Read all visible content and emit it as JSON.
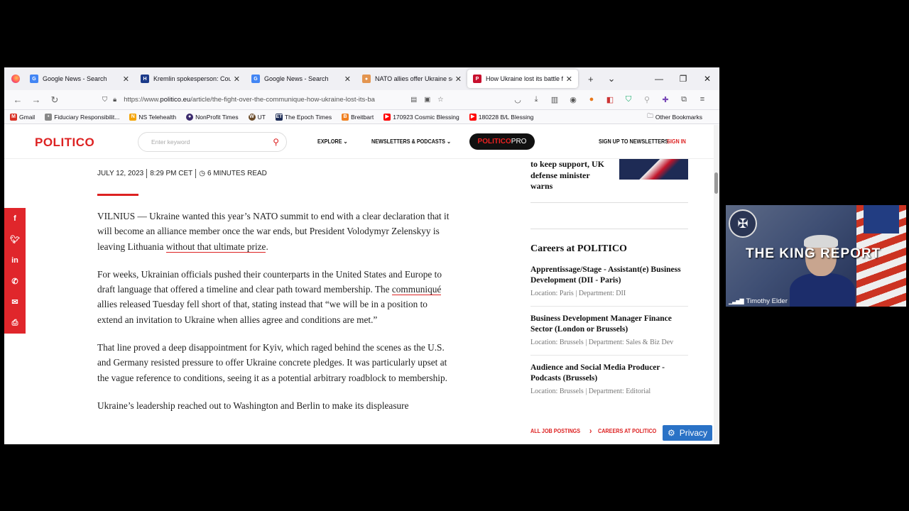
{
  "browser": {
    "tabs": [
      {
        "title": "Google News - Search",
        "fav_color": "#4285f4",
        "fav_glyph": "G"
      },
      {
        "title": "Kremlin spokesperson: Count",
        "fav_color": "#1b3a8a",
        "fav_glyph": "H"
      },
      {
        "title": "Google News - Search",
        "fav_color": "#4285f4",
        "fav_glyph": "G"
      },
      {
        "title": "NATO allies offer Ukraine secu",
        "fav_color": "#e39550",
        "fav_glyph": "●"
      },
      {
        "title": "How Ukraine lost its battle fo",
        "fav_color": "#c8102e",
        "fav_glyph": "P"
      }
    ],
    "url_prefix": "https://www.",
    "url_domain": "politico.eu",
    "url_path": "/article/the-fight-over-the-communique-how-ukraine-lost-its-ba",
    "bookmarks": [
      {
        "label": "Gmail",
        "color": "#d93025",
        "glyph": "M"
      },
      {
        "label": "Fiduciary Responsibilit...",
        "color": "#888888",
        "glyph": "•"
      },
      {
        "label": "NS Telehealth",
        "color": "#f4a300",
        "glyph": "N"
      },
      {
        "label": "NonProfit Times",
        "color": "#3b2a6d",
        "glyph": "●"
      },
      {
        "label": "UT",
        "color": "#6a4b2a",
        "glyph": "W"
      },
      {
        "label": "The Epoch Times",
        "color": "#1b2a55",
        "glyph": "ET"
      },
      {
        "label": "Breitbart",
        "color": "#f08020",
        "glyph": "B"
      },
      {
        "label": "170923 Cosmic Blessing",
        "color": "#ff0000",
        "glyph": "▶"
      },
      {
        "label": "180228 B/L Blessing",
        "color": "#ff0000",
        "glyph": "▶"
      }
    ],
    "other_bookmarks": "Other Bookmarks"
  },
  "site": {
    "logo": "POLITICO",
    "search_placeholder": "Enter keyword",
    "explore": "EXPLORE",
    "newsletters": "NEWSLETTERS & PODCASTS",
    "pro_prefix": "POLITICO",
    "pro_suffix": "PRO",
    "signup": "SIGN UP TO NEWSLETTERS",
    "signin": "SIGN IN"
  },
  "article": {
    "date": "JULY 12, 2023",
    "time": "8:29 PM CET",
    "read_time": "6 MINUTES READ",
    "p1_a": "VILNIUS — Ukraine wanted this year’s NATO summit to end with a clear declaration that it will become an alliance member once the war ends, but President Volodymyr Zelenskyy is leaving Lithuania ",
    "p1_link": "without that ultimate prize",
    "p1_b": ".",
    "p2_a": "For weeks, Ukrainian officials pushed their counterparts in the United States and Europe to draft language that offered a timeline and clear path toward membership. The ",
    "p2_link": "communiqué",
    "p2_b": " allies released Tuesday fell short of that, stating instead that “we will be in a position to extend an invitation to Ukraine when allies agree and conditions are met.”",
    "p3": "That line proved a deep disappointment for Kyiv, which raged behind the scenes as the U.S. and Germany resisted pressure to offer Ukraine concrete pledges. It was particularly upset at the vague reference to conditions, seeing it as a potential arbitrary roadblock to membership.",
    "p4": "Ukraine’s leadership reached out to Washington and Berlin to make its displeasure"
  },
  "rail": {
    "prev_story": "to keep support, UK defense minister warns",
    "careers_title": "Careers at POLITICO",
    "jobs": [
      {
        "title": "Apprentissage/Stage - Assistant(e) Business Development (DII - Paris)",
        "meta": "Location: Paris | Department: DII"
      },
      {
        "title": "Business Development Manager Finance Sector (London or Brussels)",
        "meta": "Location: Brussels | Department: Sales & Biz Dev"
      },
      {
        "title": "Audience and Social Media Producer - Podcasts (Brussels)",
        "meta": "Location: Brussels | Department: Editorial"
      }
    ],
    "all_jobs": "ALL JOB POSTINGS",
    "careers_link": "CAREERS AT POLITICO",
    "privacy": "Privacy"
  },
  "webcam": {
    "title": "THE KING REPORT",
    "name": "Timothy Elder"
  }
}
